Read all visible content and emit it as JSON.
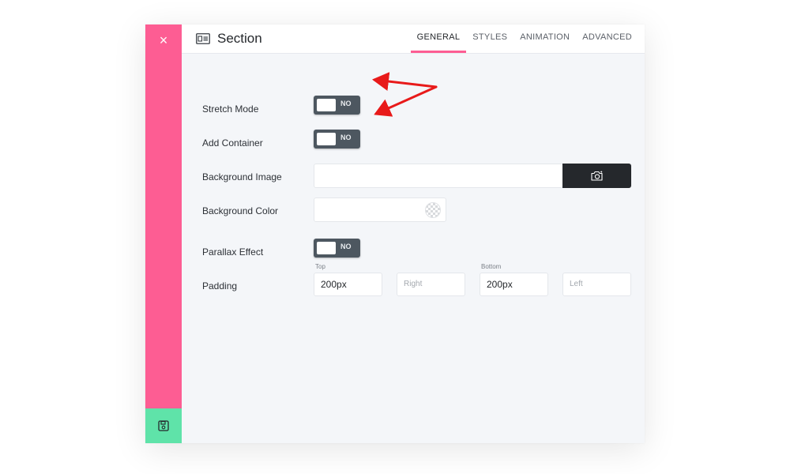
{
  "sidebar": {
    "close_glyph": "×",
    "close_icon": "close-icon",
    "save_icon": "floppy-disk-icon",
    "accent_color": "#fd5d93",
    "save_color": "#5fe3a9"
  },
  "header": {
    "icon": "section-layout-icon",
    "title": "Section",
    "tabs": [
      "GENERAL",
      "STYLES",
      "ANIMATION",
      "ADVANCED"
    ],
    "active_tab": "GENERAL"
  },
  "form": {
    "stretch_mode": {
      "label": "Stretch Mode",
      "value": "NO"
    },
    "add_container": {
      "label": "Add Container",
      "value": "NO"
    },
    "background_image": {
      "label": "Background Image",
      "value": "",
      "button_icon": "camera-icon"
    },
    "background_color": {
      "label": "Background Color",
      "value": "",
      "swatch_icon": "transparent-checker-icon"
    },
    "parallax_effect": {
      "label": "Parallax Effect",
      "value": "NO"
    },
    "padding": {
      "label": "Padding",
      "top": {
        "caption": "Top",
        "value": "200px"
      },
      "right": {
        "caption": "",
        "placeholder": "Right"
      },
      "bottom": {
        "caption": "Bottom",
        "value": "200px"
      },
      "left": {
        "caption": "",
        "placeholder": "Left"
      }
    }
  },
  "annotations": {
    "arrow_color": "#e81a1a",
    "arrow_icon": "red-arrow-icon"
  }
}
